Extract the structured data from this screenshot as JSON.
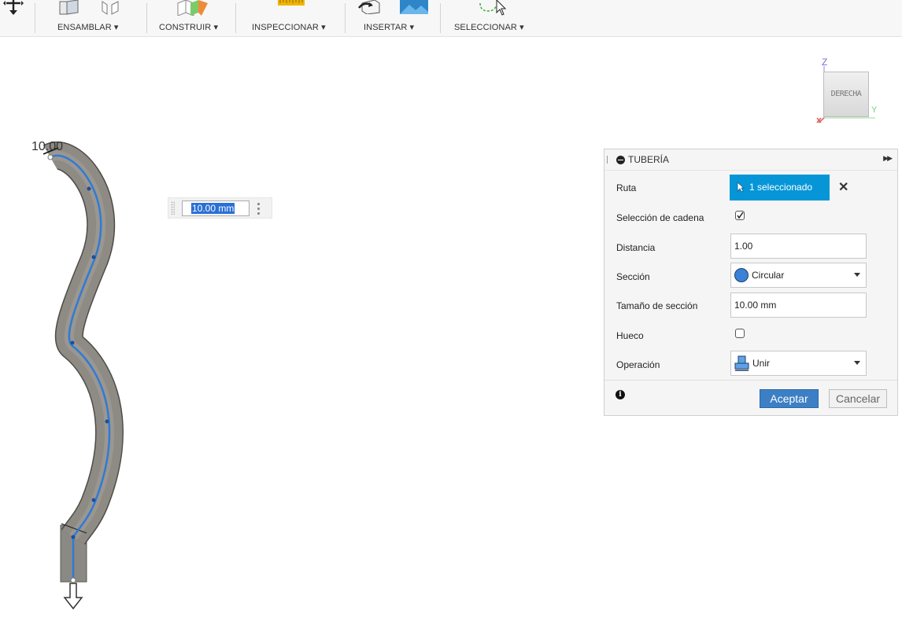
{
  "toolbar": {
    "groups": [
      {
        "label": "ENSAMBLAR ▾"
      },
      {
        "label": "CONSTRUIR ▾"
      },
      {
        "label": "INSPECCIONAR ▾"
      },
      {
        "label": "INSERTAR ▾"
      },
      {
        "label": "SELECCIONAR ▾"
      }
    ]
  },
  "viewport": {
    "dimension_label": "10.00",
    "dimension_input_value": "10.00 mm"
  },
  "viewcube": {
    "face_label": "DERECHA",
    "axis_z": "Z",
    "axis_x": "X",
    "axis_y": "Y"
  },
  "panel": {
    "title": "TUBERÍA",
    "rows": {
      "ruta": {
        "label": "Ruta",
        "value": "1 seleccionado"
      },
      "cadena": {
        "label": "Selección de cadena",
        "checked": true
      },
      "distancia": {
        "label": "Distancia",
        "value": "1.00"
      },
      "seccion": {
        "label": "Sección",
        "value": "Circular"
      },
      "tamano": {
        "label": "Tamaño de sección",
        "value": "10.00 mm"
      },
      "hueco": {
        "label": "Hueco",
        "checked": false
      },
      "operacion": {
        "label": "Operación",
        "value": "Unir"
      }
    },
    "ok_label": "Aceptar",
    "cancel_label": "Cancelar"
  },
  "colors": {
    "accent": "#0696d7",
    "ok_button": "#3c7fc4",
    "path_line": "#2f7bd6",
    "pipe_body": "#8a8780"
  },
  "icons": [
    "move-icon",
    "assemble-icon",
    "joint-icon",
    "construct-plane-icon",
    "measure-icon",
    "insert-mesh-icon",
    "insert-image-icon",
    "select-icon",
    "cursor-icon",
    "circle-section-icon",
    "join-operation-icon",
    "info-icon",
    "close-icon"
  ]
}
